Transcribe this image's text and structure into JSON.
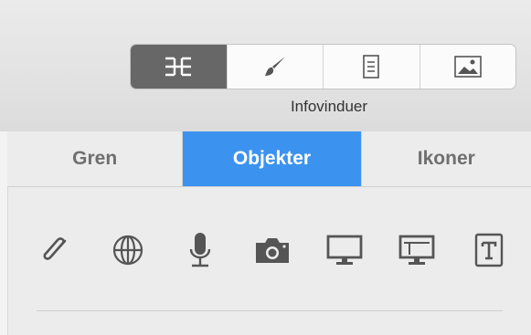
{
  "toolbar": {
    "inspector_label": "Infovinduer",
    "segments": [
      {
        "icon": "outline-structure-icon",
        "active": true
      },
      {
        "icon": "paintbrush-icon",
        "active": false
      },
      {
        "icon": "document-icon",
        "active": false
      },
      {
        "icon": "image-icon",
        "active": false
      }
    ]
  },
  "tabs": [
    {
      "label": "Gren",
      "active": false
    },
    {
      "label": "Objekter",
      "active": true
    },
    {
      "label": "Ikoner",
      "active": false
    }
  ],
  "objects": [
    "paperclip-icon",
    "globe-icon",
    "microphone-icon",
    "camera-icon",
    "monitor-icon",
    "presentation-icon",
    "text-box-icon"
  ],
  "colors": {
    "accent": "#3c93ef",
    "active_segment": "#676767"
  }
}
